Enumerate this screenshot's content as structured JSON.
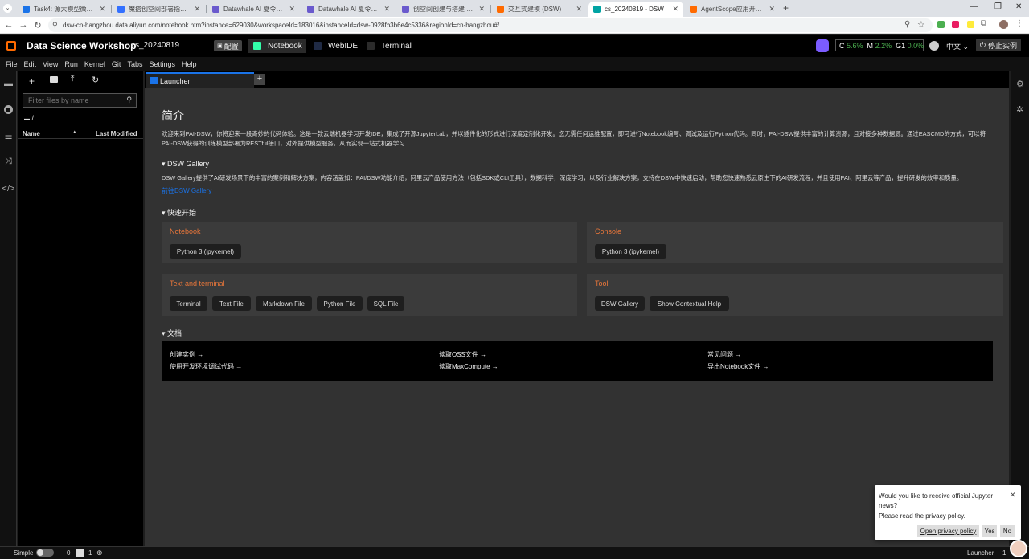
{
  "browser": {
    "tabs": [
      {
        "title": "Task4: 源大模型微调实战·知乎",
        "color": "#1a73e8"
      },
      {
        "title": "魔搭创空间部署指南 - 飞书云文档",
        "color": "#3370ff"
      },
      {
        "title": "Datawhale AI 夏令营第四期 - 大模型应用开发",
        "color": "#6a5acd"
      },
      {
        "title": "Datawhale AI 夏令营第四期 - 大模型应用开发",
        "color": "#6a5acd"
      },
      {
        "title": "创空间创建与搭建 · 文档中心",
        "color": "#6a5acd"
      },
      {
        "title": "交互式建模 (DSW)",
        "color": "#ff6a00"
      },
      {
        "title": "cs_20240819 - DSW",
        "color": "#00a3a3"
      },
      {
        "title": "AgentScope应用开发入门 - 飞书",
        "color": "#ff6a00"
      }
    ],
    "url": "dsw-cn-hangzhou.data.aliyun.com/notebook.htm?instance=629030&workspaceId=183016&instanceId=dsw-0928fb3b6e4c5336&regionId=cn-hangzhou#/"
  },
  "pai": {
    "brand": "Data Science Workshop",
    "instance": "cs_20240819",
    "config_btn": "配置",
    "tabs": [
      "Notebook",
      "WebIDE",
      "Terminal"
    ],
    "stats": {
      "c_label": "C",
      "c": "5.6%",
      "m_label": "M",
      "m": "2.2%",
      "g_label": "G1",
      "g": "0.0%"
    },
    "lang": "中文",
    "stop": "停止实例"
  },
  "menu": [
    "File",
    "Edit",
    "View",
    "Run",
    "Kernel",
    "Git",
    "Tabs",
    "Settings",
    "Help"
  ],
  "filebrowser": {
    "filter_placeholder": "Filter files by name",
    "path": "/",
    "col_name": "Name",
    "col_modified": "Last Modified"
  },
  "launcher": {
    "tab_label": "Launcher",
    "intro_title": "简介",
    "intro_text_1": "欢迎来到PAI-DSW，你将迎来一段奇妙的代码体验。这是一款云端机器学习开发IDE，集成了开源JupyterLab，并以插件化的形式进行深度定制化开发。您无需任何运维配置，即可进行Notebook编写、调试及运行Python代码。同时，PAI-DSW提供丰富的计算资源，且对接多种数据源。通过EASCMD的方式，可以将",
    "intro_text_2": "PAI-DSW获得的训练模型部署为RESTful接口，对外提供模型服务，从而实现一站式机器学习",
    "gallery_title": "▾ DSW Gallery",
    "gallery_text": "DSW Gallery提供了AI研发场景下的丰富的案例和解决方案，内容涵盖如：PAI/DSW功能介绍，阿里云产品使用方法（包括SDK或CLI工具），数据科学，深度学习，以及行业解决方案，支持在DSW中快速启动，帮助您快速熟悉云原生下的AI研发流程，并且使用PAI、阿里云等产品，提升研发的效率和质量。",
    "gallery_link": "前往DSW Gallery",
    "quick_title": "▾ 快速开始",
    "notebook_card": "Notebook",
    "notebook_kernel": "Python 3 (ipykernel)",
    "console_card": "Console",
    "console_kernel": "Python 3 (ipykernel)",
    "text_card": "Text and terminal",
    "text_items": [
      "Terminal",
      "Text File",
      "Markdown File",
      "Python File",
      "SQL File"
    ],
    "tool_card": "Tool",
    "tool_items": [
      "DSW Gallery",
      "Show Contextual Help"
    ],
    "docs_title": "▾ 文档",
    "docs": [
      [
        "创建实例 →",
        "使用开发环境调试代码 →"
      ],
      [
        "读取OSS文件 →",
        "读取MaxCompute →"
      ],
      [
        "常见问题 →",
        "导出Notebook文件 →"
      ]
    ]
  },
  "notice": {
    "line1": "Would you like to receive official Jupyter",
    "line2": "news?",
    "line3": "Please read the privacy policy.",
    "open": "Open privacy policy",
    "yes": "Yes",
    "no": "No"
  },
  "status": {
    "mode": "Simple",
    "a": "0",
    "b": "1",
    "right": "Launcher",
    "right_num": "1"
  }
}
